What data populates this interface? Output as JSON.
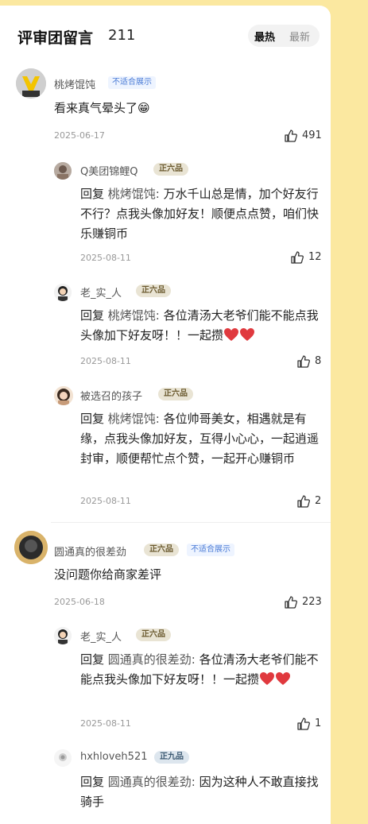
{
  "header": {
    "title": "评审团留言",
    "count": "211",
    "sort_hot": "最热",
    "sort_new": "最新"
  },
  "comments": [
    {
      "author": "桃烤馄饨",
      "badge": "不适合展示",
      "text": "看来真气晕头了😁",
      "date": "2025-06-17",
      "likes": "491",
      "replies": [
        {
          "author": "Q美团锦鲤Q",
          "rank": "正六品",
          "reply_prefix": "回复",
          "reply_to": "桃烤馄饨:",
          "text": "万水千山总是情，加个好友行不行？点我头像加好友！顺便点点赞，咱们快乐赚铜币",
          "date": "2025-08-11",
          "likes": "12"
        },
        {
          "author": "老_实_人",
          "rank": "正六品",
          "reply_prefix": "回复",
          "reply_to": "桃烤馄饨:",
          "text": "各位清汤大老爷们能不能点我头像加下好友呀！！一起攒",
          "date": "2025-08-11",
          "likes": "8"
        },
        {
          "author": "被选召的孩子",
          "rank": "正六品",
          "reply_prefix": "回复",
          "reply_to": "桃烤馄饨:",
          "text": "各位帅哥美女，相遇就是有缘，点我头像加好友，互得小心心，一起逍遥封审，顺便帮忙点个赞，一起开心赚铜币",
          "date": "2025-08-11",
          "likes": "2"
        }
      ]
    },
    {
      "author": "圆通真的很差劲",
      "rank": "正六品",
      "badge": "不适合展示",
      "text": "没问题你给商家差评",
      "date": "2025-06-18",
      "likes": "223",
      "replies": [
        {
          "author": "老_实_人",
          "rank": "正六品",
          "reply_prefix": "回复",
          "reply_to": "圆通真的很差劲:",
          "text": "各位清汤大老爷们能不能点我头像加下好友呀！！一起攒",
          "date": "2025-08-11",
          "likes": "1"
        },
        {
          "author": "hxhloveh521",
          "rank": "正九品",
          "reply_prefix": "回复",
          "reply_to": "圆通真的很差劲:",
          "text": "因为这种人不敢直接找骑手",
          "date": "",
          "likes": ""
        }
      ]
    }
  ],
  "colors": {
    "background": "#fbe8a0",
    "heart": "#e0393e",
    "link_badge": "#4a7bd6"
  }
}
